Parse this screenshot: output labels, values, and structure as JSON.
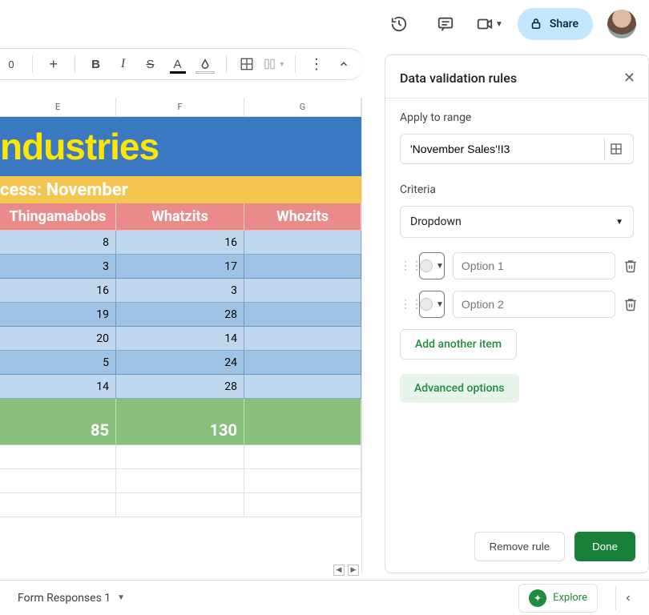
{
  "topbar": {
    "share_label": "Share"
  },
  "toolbar": {
    "zoom": "0",
    "strike_char": "S",
    "bold_char": "B",
    "italic_char": "I"
  },
  "columns": [
    "E",
    "F",
    "G"
  ],
  "sheet": {
    "title": "ndustries",
    "subtitle": "cess: November",
    "headers": [
      "Thingamabobs",
      "Whatzits",
      "Whozits"
    ],
    "rows": [
      [
        "8",
        "16",
        ""
      ],
      [
        "3",
        "17",
        ""
      ],
      [
        "16",
        "3",
        ""
      ],
      [
        "19",
        "28",
        ""
      ],
      [
        "20",
        "14",
        ""
      ],
      [
        "5",
        "24",
        ""
      ],
      [
        "14",
        "28",
        ""
      ]
    ],
    "totals": [
      "85",
      "130",
      ""
    ]
  },
  "panel": {
    "title": "Data validation rules",
    "apply_label": "Apply to range",
    "range_value": "'November Sales'!I3",
    "criteria_label": "Criteria",
    "criteria_value": "Dropdown",
    "options": [
      {
        "placeholder": "Option 1"
      },
      {
        "placeholder": "Option 2"
      }
    ],
    "add_item": "Add another item",
    "advanced": "Advanced options",
    "remove": "Remove rule",
    "done": "Done"
  },
  "tabs": {
    "form_responses": "Form Responses 1",
    "explore": "Explore"
  }
}
